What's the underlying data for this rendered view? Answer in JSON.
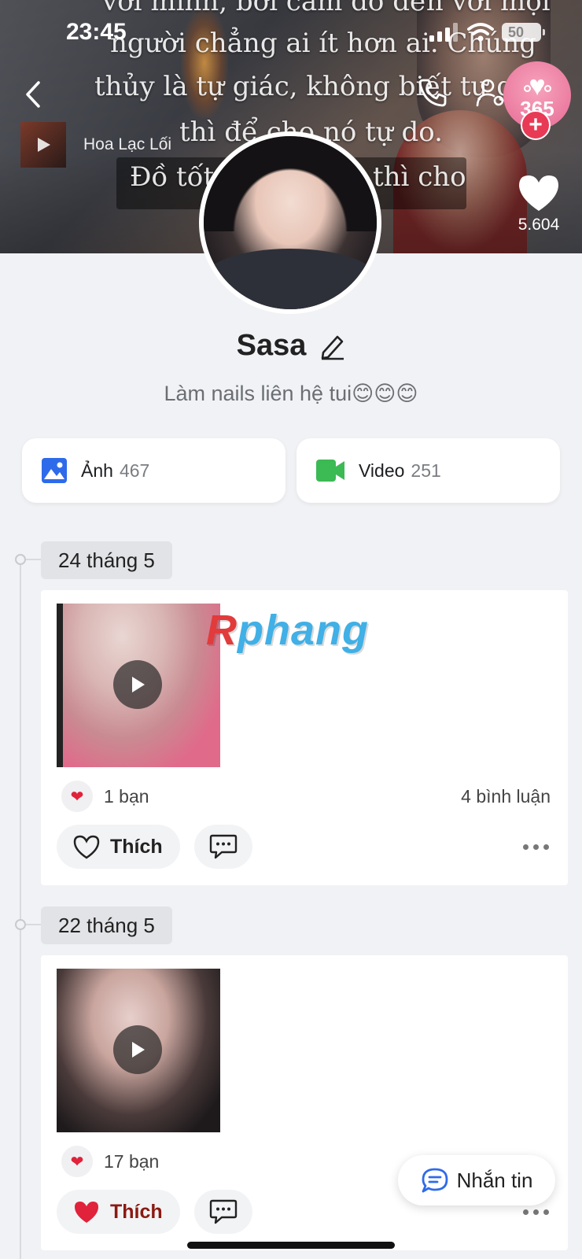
{
  "status_bar": {
    "time": "23:45",
    "battery": "50"
  },
  "cover": {
    "lyric_lines": [
      "với mình, bởi cảm do đến với mọi",
      "người chẳng ai ít hơn ai. Chúng",
      "thủy là tự giác, không biết tự giác",
      "thì để cho nó tự do.",
      "Đồ tốt",
      "thì cho"
    ],
    "music_title": "Hoa Lạc Lối",
    "badge_number": "365",
    "like_count": "5.604"
  },
  "profile": {
    "name": "Sasa",
    "bio": "Làm nails liên hệ tui😊😊😊"
  },
  "media": {
    "photos": {
      "label": "Ảnh",
      "count": "467"
    },
    "videos": {
      "label": "Video",
      "count": "251"
    }
  },
  "watermark": {
    "first": "R",
    "rest": "phang"
  },
  "posts": [
    {
      "date": "24 tháng 5",
      "reactions": "1 bạn",
      "comments": "4 bình luận",
      "like_label": "Thích",
      "liked": false
    },
    {
      "date": "22 tháng 5",
      "reactions": "17 bạn",
      "comments": "",
      "like_label": "Thích",
      "liked": true
    }
  ],
  "chat_fab": {
    "label": "Nhắn tin"
  },
  "colors": {
    "accent_blue": "#2e6bea",
    "video_green": "#3cba54",
    "heart_red": "#e0223a",
    "badge_pink": "#e66a94"
  }
}
